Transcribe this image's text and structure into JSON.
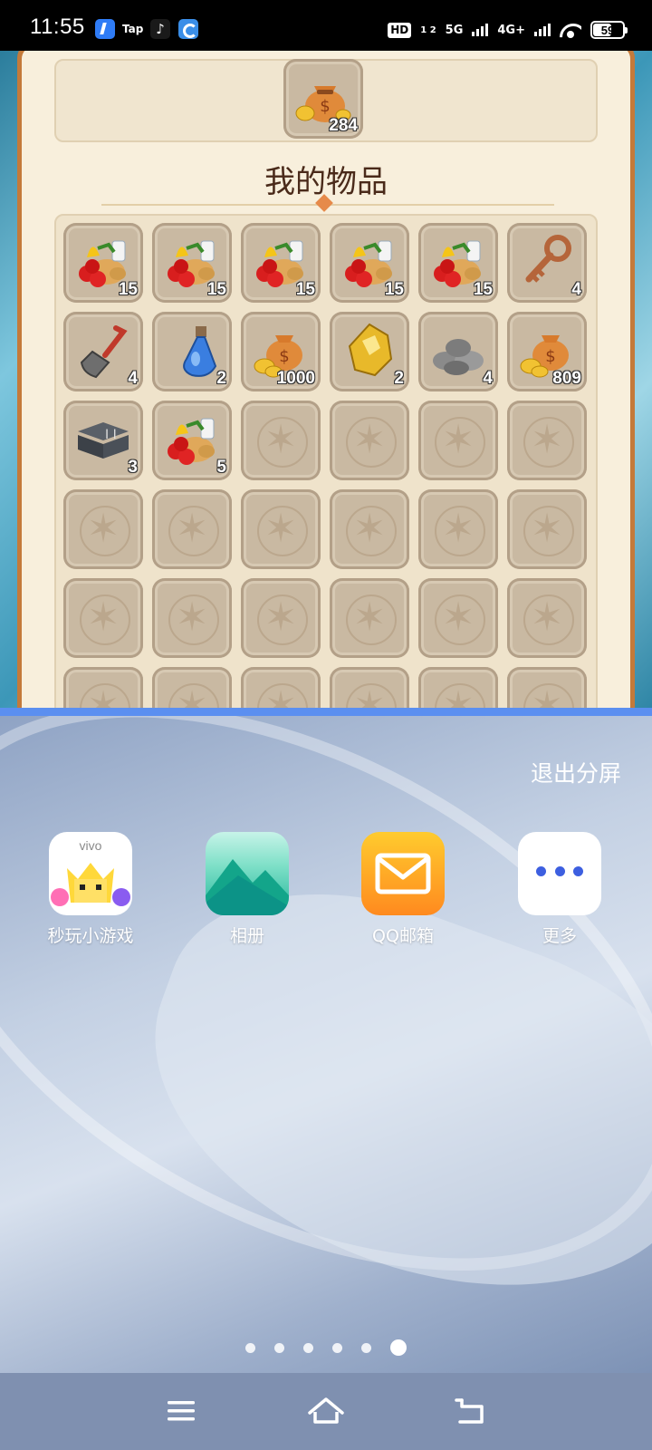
{
  "status_bar": {
    "time": "11:55",
    "app_tap_label": "Tap",
    "hd_label": "HD",
    "hd_sub": "1 2",
    "net_5g": "5G",
    "net_4g": "4G+",
    "battery": "59",
    "battery_level": 0.59
  },
  "game": {
    "reward_count": "284",
    "section_title": "我的物品",
    "items": [
      {
        "icon": "food-basket-icon",
        "count": "15"
      },
      {
        "icon": "food-basket-icon",
        "count": "15"
      },
      {
        "icon": "food-basket-icon",
        "count": "15"
      },
      {
        "icon": "food-basket-icon",
        "count": "15"
      },
      {
        "icon": "food-basket-icon",
        "count": "15"
      },
      {
        "icon": "key-icon",
        "count": "4"
      },
      {
        "icon": "shovel-icon",
        "count": "4"
      },
      {
        "icon": "potion-icon",
        "count": "2"
      },
      {
        "icon": "coin-bag-icon",
        "count": "1000"
      },
      {
        "icon": "gold-ore-icon",
        "count": "2"
      },
      {
        "icon": "stone-pile-icon",
        "count": "4"
      },
      {
        "icon": "coin-bag-icon",
        "count": "809"
      },
      {
        "icon": "steel-beam-icon",
        "count": "3"
      },
      {
        "icon": "food-basket-icon",
        "count": "5"
      }
    ]
  },
  "launcher": {
    "exit_split": "退出分屏",
    "apps": [
      {
        "label": "秒玩小游戏",
        "icon": "vivo-games-icon",
        "brand": "vivo"
      },
      {
        "label": "相册",
        "icon": "gallery-icon"
      },
      {
        "label": "QQ邮箱",
        "icon": "qq-mail-icon"
      },
      {
        "label": "更多",
        "icon": "more-icon"
      }
    ],
    "page_count": 6,
    "active_page": 6
  },
  "colors": {
    "split_divider": "#5b8ff0",
    "panel_bg": "#f8efdc",
    "frame": "#c47a3a",
    "title": "#4a2a1a",
    "nav_bar": "#7f90b0"
  }
}
